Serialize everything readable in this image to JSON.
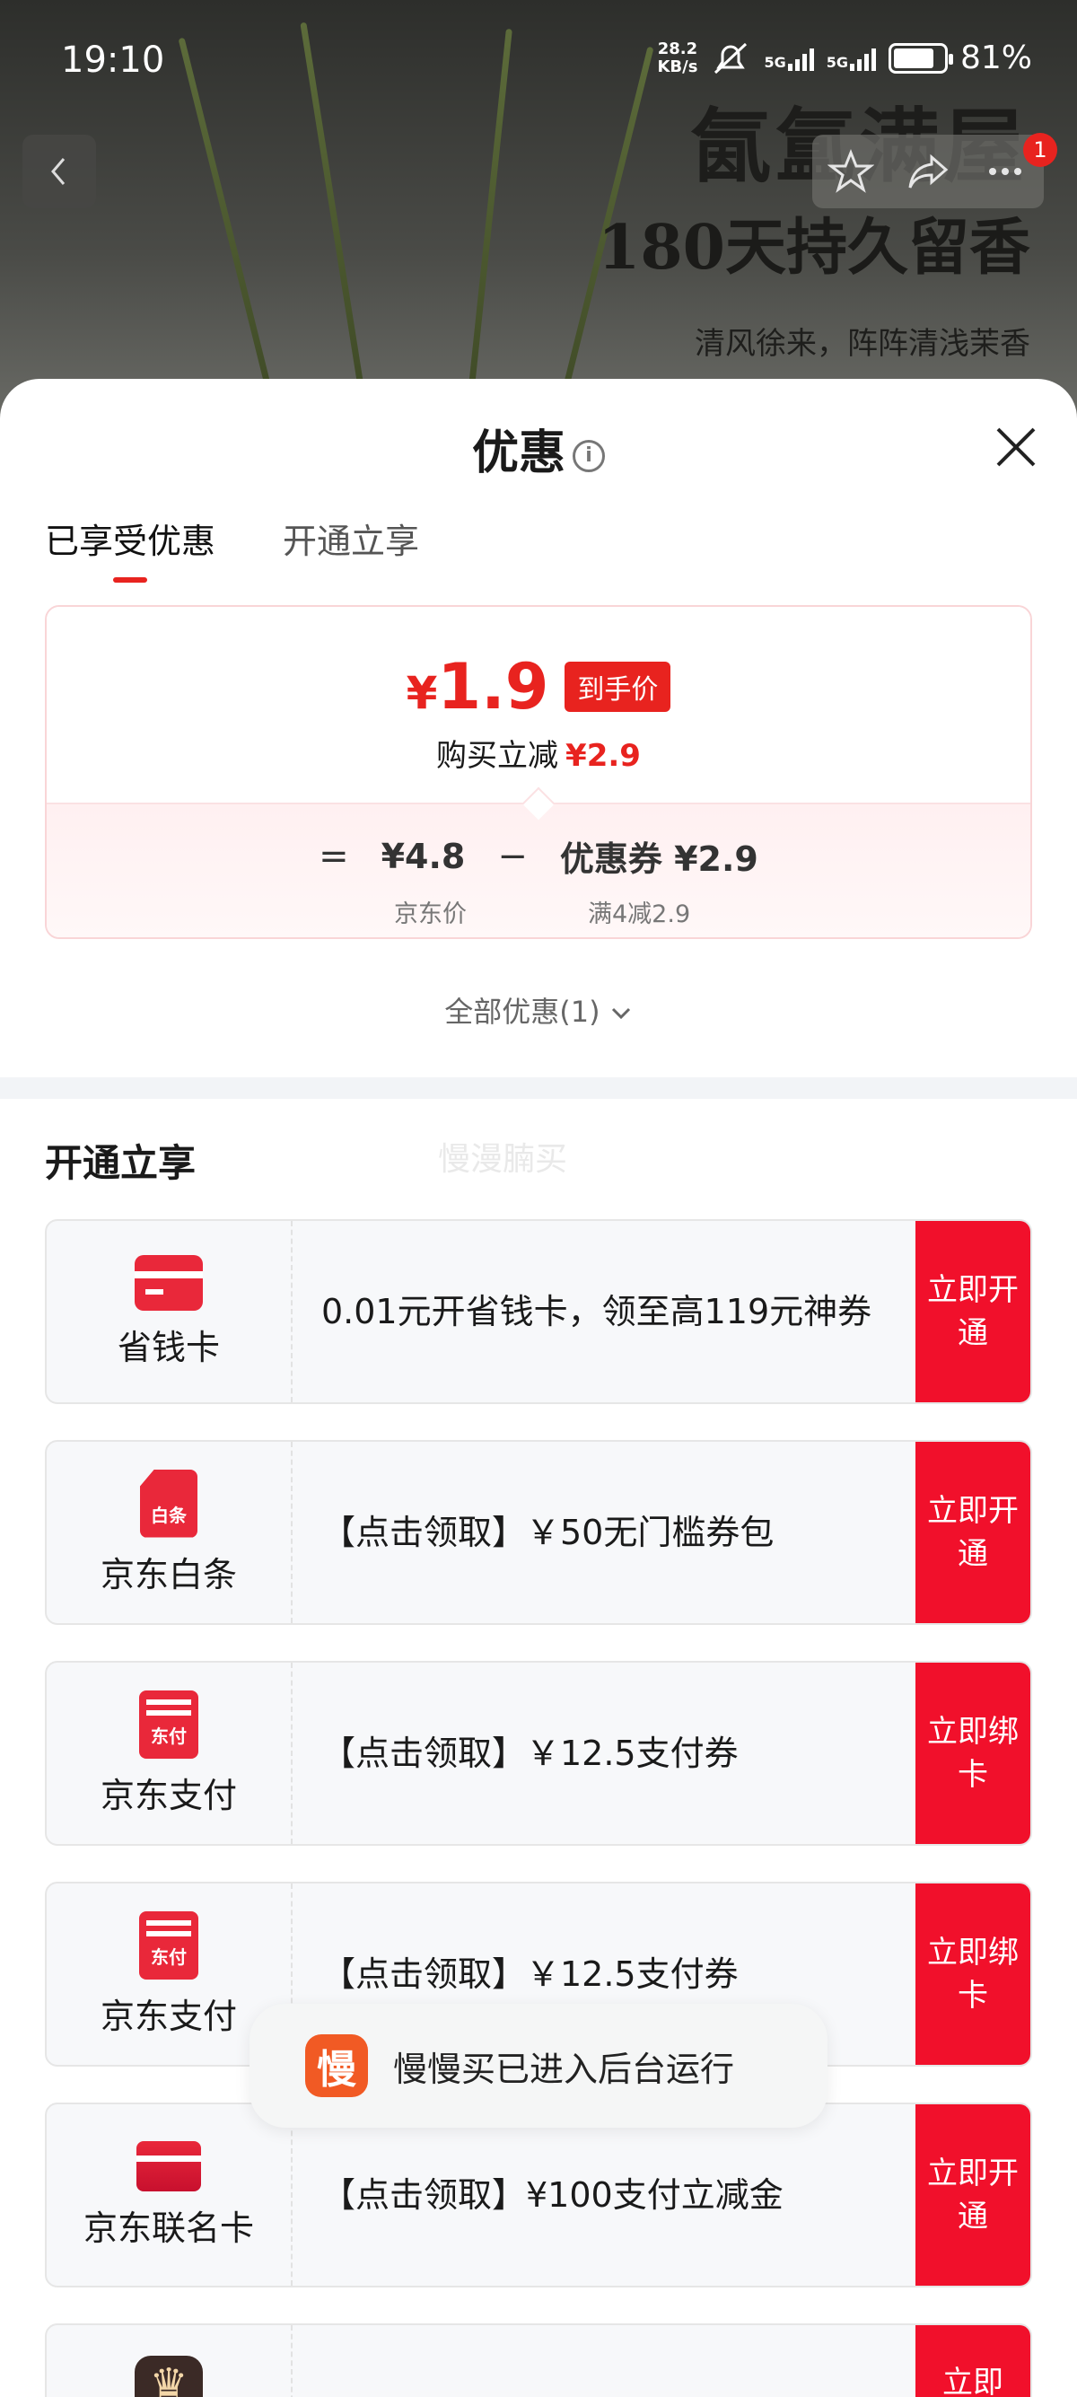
{
  "status_bar": {
    "time": "19:10",
    "net_speed_value": "28.2",
    "net_speed_unit": "KB/s",
    "sim1": "5G",
    "sim2": "5G",
    "battery": "81%",
    "battery_level": 0.81
  },
  "hero": {
    "title": "氤氲满屋",
    "subtitle": "180天持久留香",
    "line": "清风徐来，阵阵清浅茉香"
  },
  "nav": {
    "badge_count": "1",
    "icons": [
      "back-icon",
      "star-icon",
      "share-icon",
      "more-icon"
    ]
  },
  "sheet": {
    "title": "优惠",
    "info_glyph": "i",
    "tabs": [
      "已享受优惠",
      "开通立享"
    ],
    "active_tab": 0
  },
  "price_card": {
    "yen": "¥",
    "price": "1.9",
    "price_tag": "到手价",
    "reduce_label": "购买立减",
    "reduce_value": "¥2.9",
    "eq": "=",
    "minus": "−",
    "jd_price": "¥4.8",
    "jd_price_label": "京东价",
    "coupon": "优惠券 ¥2.9",
    "coupon_label": "满4减2.9"
  },
  "all_offers": "全部优惠(1)",
  "section": {
    "title": "开通立享",
    "watermark": "慢漫腩买"
  },
  "offers": [
    {
      "name": "省钱卡",
      "text": "0.01元开省钱卡，领至高119元神券",
      "btn": "立即开通",
      "icon": "card-icon"
    },
    {
      "name": "京东白条",
      "icon_text": "白条",
      "text": "【点击领取】￥50无门槛券包",
      "btn": "立即开通",
      "icon": "baitiao-icon"
    },
    {
      "name": "京东支付",
      "icon_text": "东付",
      "text": "【点击领取】￥12.5支付券",
      "btn": "立即绑卡",
      "icon": "jdpay-icon"
    },
    {
      "name": "京东支付",
      "icon_text": "东付",
      "text": "【点击领取】￥12.5支付券",
      "btn": "立即绑卡",
      "icon": "jdpay-icon"
    },
    {
      "name": "京东联名卡",
      "text": "【点击领取】¥100支付立减金",
      "btn": "立即开通",
      "icon": "cobrand-card-icon"
    },
    {
      "name": "",
      "text": "",
      "btn": "立即",
      "icon": "plus-icon"
    }
  ],
  "toast": {
    "icon_text": "慢",
    "text": "慢慢买已进入后台运行"
  },
  "colors": {
    "accent_red": "#e8231f",
    "button_red": "#f1102b",
    "toast_orange": "#f15a24"
  }
}
